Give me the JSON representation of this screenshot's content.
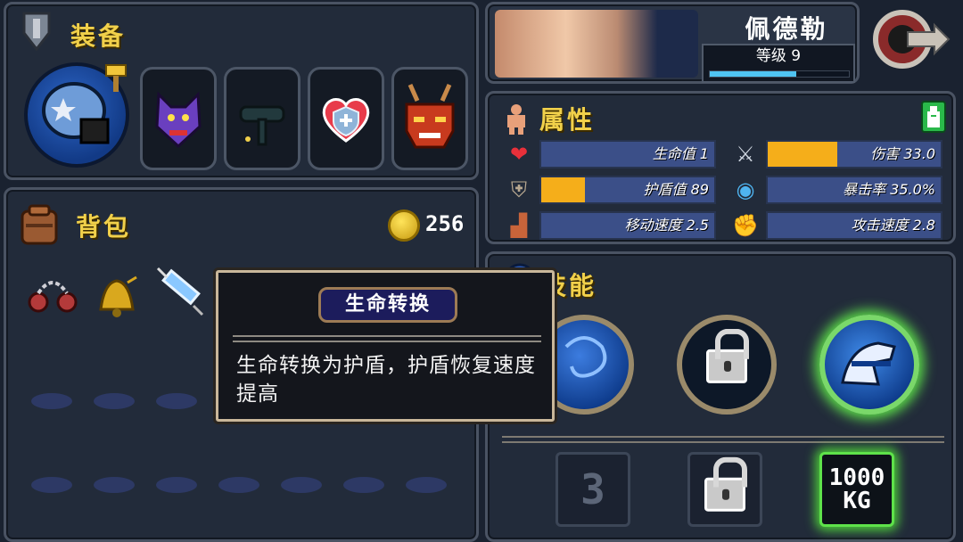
{
  "equipment": {
    "title": "装备",
    "slots": [
      "main-weapon",
      "wolf-helmet",
      "black-belt",
      "heart-shield",
      "oni-mask"
    ]
  },
  "backpack": {
    "title": "背包",
    "coins": "256",
    "items": [
      "spiked-chain",
      "golden-bell",
      "syringe"
    ]
  },
  "tooltip": {
    "title": "生命转换",
    "description": "生命转换为护盾，护盾恢复速度提高"
  },
  "hero": {
    "name": "佩德勒",
    "level_label": "等级 9",
    "xp_fraction": 0.62
  },
  "attributes": {
    "title": "属性",
    "items": [
      {
        "label": "生命值 1",
        "fill": 0.0
      },
      {
        "label": "伤害 33.0",
        "fill": 0.4
      },
      {
        "label": "护盾值 89",
        "fill": 0.25
      },
      {
        "label": "暴击率 35.0%",
        "fill": 0.0
      },
      {
        "label": "移动速度 2.5",
        "fill": 0.0
      },
      {
        "label": "攻击速度 2.8",
        "fill": 0.0
      }
    ]
  },
  "skills": {
    "title": "技能",
    "talents": [
      "3",
      "1000\nKG"
    ]
  },
  "colors": {
    "accent": "#f1d04a",
    "bar": "#3b4f88",
    "bar_fill": "#f5ae1a",
    "glow": "#5ee24a"
  }
}
